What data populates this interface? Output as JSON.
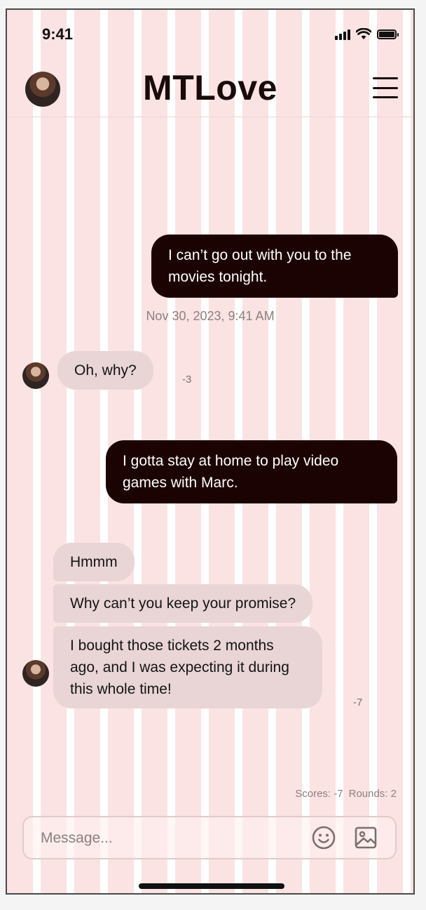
{
  "status_bar": {
    "time": "9:41",
    "icons": [
      "cellular-signal-icon",
      "wifi-icon",
      "battery-icon"
    ]
  },
  "header": {
    "title": "MTLove",
    "avatar_icon": "user-avatar",
    "menu_icon": "hamburger-menu-icon"
  },
  "messages": {
    "out_1": "I can’t go out with you to the movies tonight.",
    "timestamp": "Nov 30, 2023, 9:41 AM",
    "in_1": "Oh, why?",
    "in_1_score": "-3",
    "out_2": "I gotta stay at home to play video games with Marc.",
    "in_2a": "Hmmm",
    "in_2b": "Why can’t you keep your promise?",
    "in_2c": "I bought those tickets 2 months ago, and I was expecting it during this whole time!",
    "in_2_score": "-7"
  },
  "footer": {
    "scores_label": "Scores: -7",
    "rounds_label": "Rounds: 2"
  },
  "composer": {
    "placeholder": "Message...",
    "emoji_icon": "smiley-icon",
    "image_icon": "image-icon"
  },
  "colors": {
    "background": "#fbe3e3",
    "outgoing_bubble": "#1c0303",
    "incoming_bubble": "#e9d5d5",
    "title": "#1a0b0b"
  }
}
